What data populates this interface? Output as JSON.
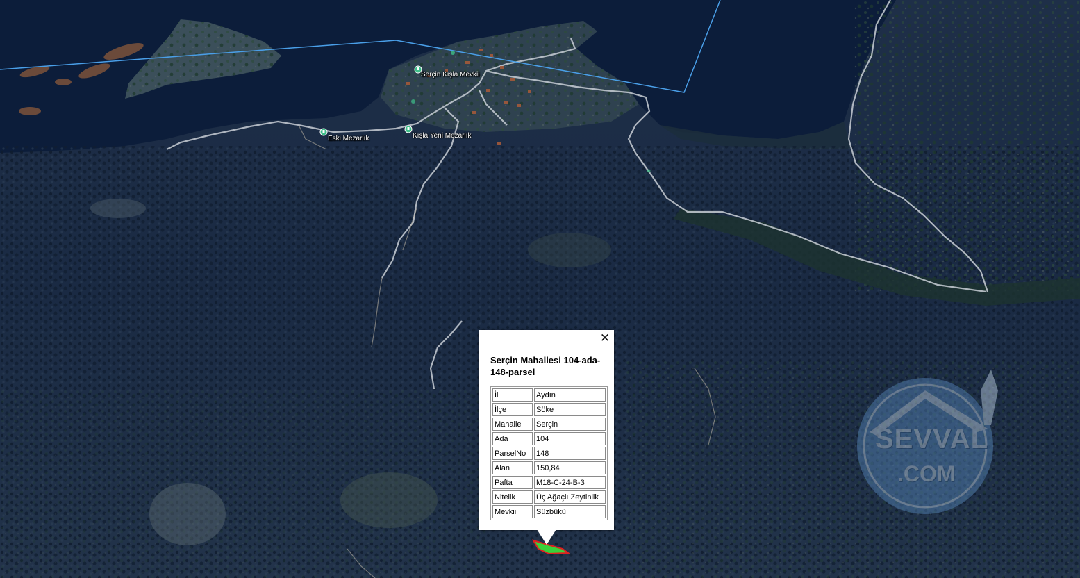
{
  "map": {
    "places": [
      {
        "id": "sercin-kisla-mevkii",
        "name": "Serçin Kışla Mevkii"
      },
      {
        "id": "eski-mezarlik",
        "name": "Eski Mezarlık"
      },
      {
        "id": "kisla-yeni-mezarlik",
        "name": "Kışla Yeni Mezarlık"
      }
    ],
    "colors": {
      "water": "#0c1d3a",
      "forest": "#15253b",
      "road": "#c9cfd6",
      "boundary_line": "#4a9fe8",
      "poi_marker": "#3fbf8a",
      "parcel_fill": "#3ad13a",
      "parcel_outline": "#e02020"
    }
  },
  "popup": {
    "title": "Serçin Mahallesi 104-ada-148-parsel",
    "close_icon": "close-icon",
    "attributes": [
      {
        "key": "İl",
        "value": "Aydın"
      },
      {
        "key": "İlçe",
        "value": "Söke"
      },
      {
        "key": "Mahalle",
        "value": "Serçin"
      },
      {
        "key": "Ada",
        "value": "104"
      },
      {
        "key": "ParselNo",
        "value": "148"
      },
      {
        "key": "Alan",
        "value": "150,84"
      },
      {
        "key": "Pafta",
        "value": "M18-C-24-B-3"
      },
      {
        "key": "Nitelik",
        "value": "Üç Ağaçlı Zeytinlik"
      },
      {
        "key": "Mevkii",
        "value": "Süzbükü"
      }
    ]
  },
  "watermark": {
    "line1": "SEVVAL",
    "line2": ".COM"
  }
}
